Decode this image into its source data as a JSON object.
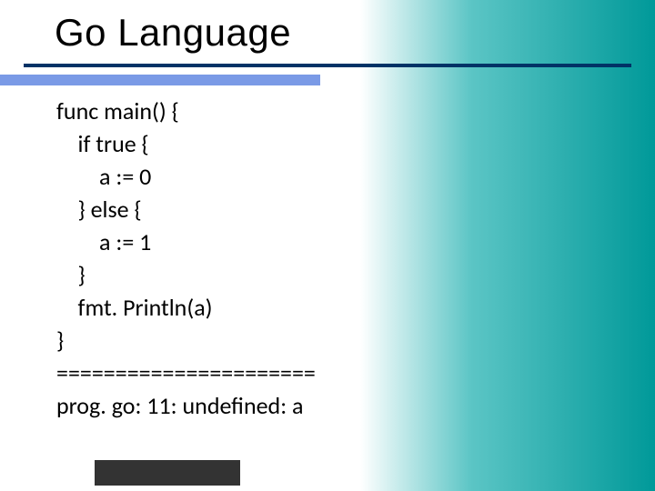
{
  "title": "Go Language",
  "code": "func main() {\n    if true {\n        a := 0\n    } else {\n        a := 1\n    }\n    fmt. Println(a)\n}\n======================\nprog. go: 11: undefined: a"
}
